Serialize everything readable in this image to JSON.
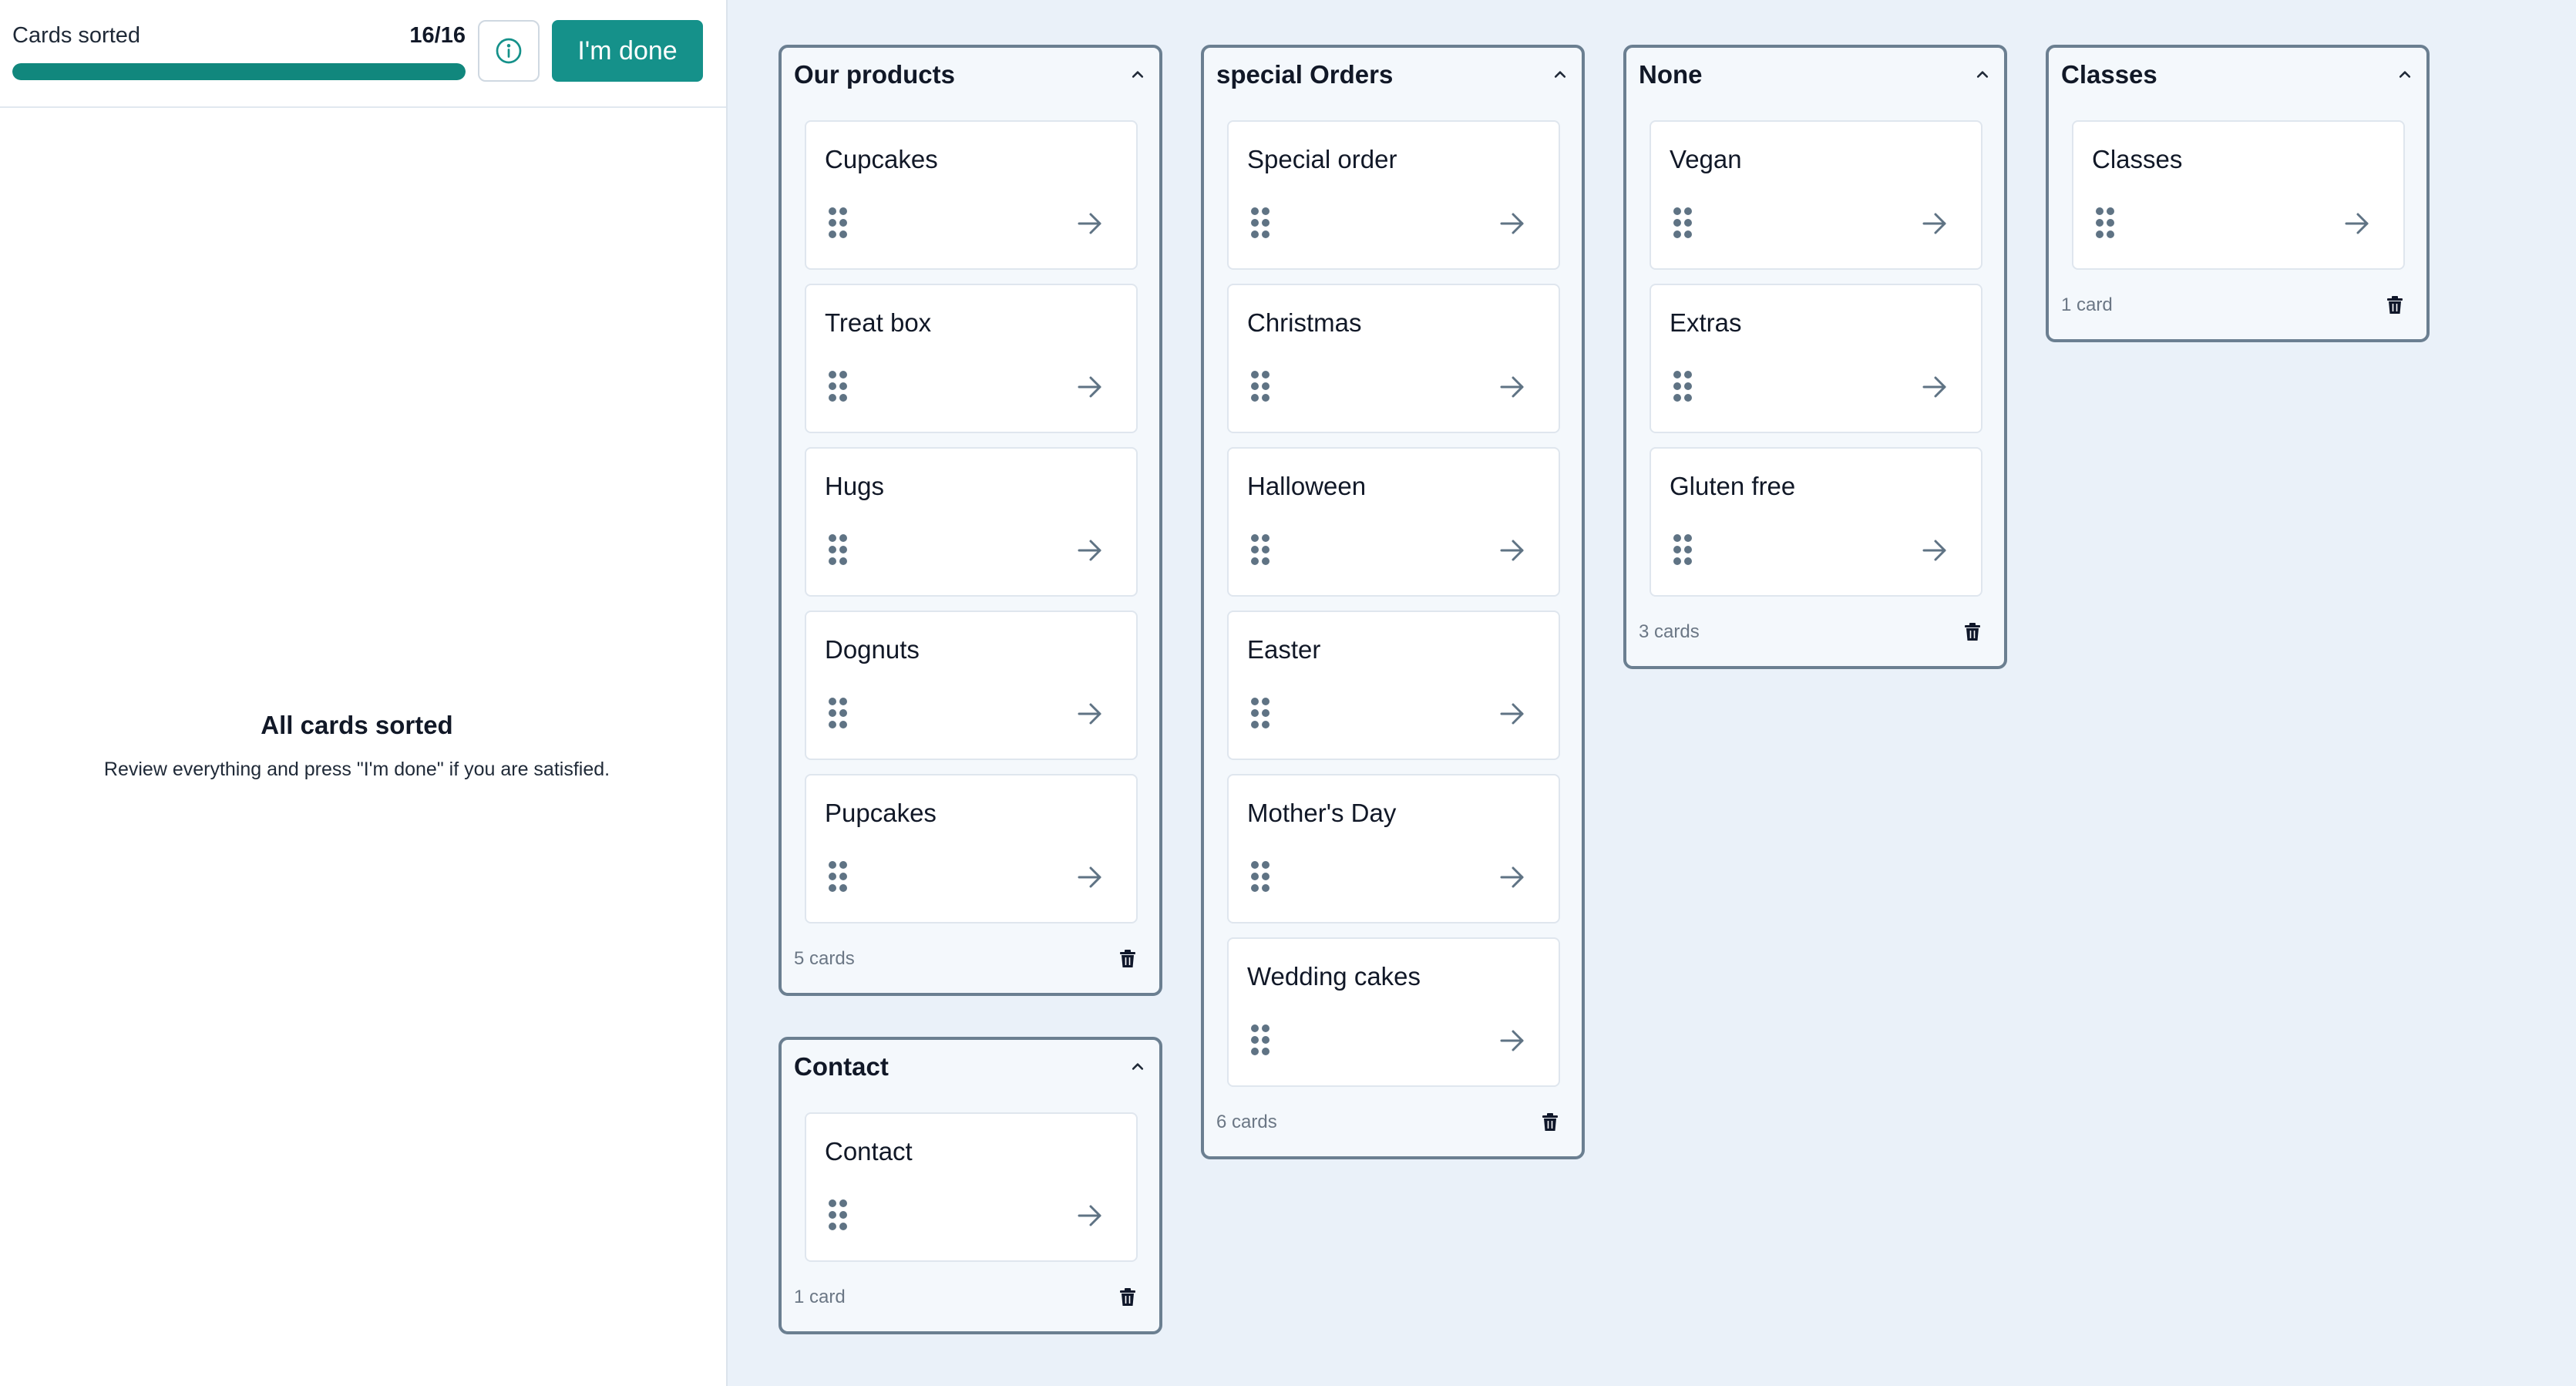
{
  "header": {
    "sorted_label": "Cards sorted",
    "sorted_count": "16/16",
    "progress": 1.0,
    "info_icon": "info-circle-icon",
    "done_label": "I'm done"
  },
  "empty_state": {
    "title": "All cards sorted",
    "description": "Review everything and press \"I'm done\" if you are satisfied."
  },
  "colors": {
    "accent": "#15918a",
    "progress_fill": "#11877d",
    "board_bg": "#eaf1f9",
    "category_border": "#6b7f91",
    "icon": "#5f7384"
  },
  "categories": [
    {
      "title": "Our products",
      "cards": [
        "Cupcakes",
        "Treat box",
        "Hugs",
        "Dognuts",
        "Pupcakes"
      ],
      "count_label": "5 cards"
    },
    {
      "title": "Contact",
      "cards": [
        "Contact"
      ],
      "count_label": "1 card"
    },
    {
      "title": "special Orders",
      "cards": [
        "Special order",
        "Christmas",
        "Halloween",
        "Easter",
        "Mother's Day",
        "Wedding cakes"
      ],
      "count_label": "6 cards"
    },
    {
      "title": "None",
      "cards": [
        "Vegan",
        "Extras",
        "Gluten free"
      ],
      "count_label": "3 cards"
    },
    {
      "title": "Classes",
      "cards": [
        "Classes"
      ],
      "count_label": "1 card"
    }
  ]
}
